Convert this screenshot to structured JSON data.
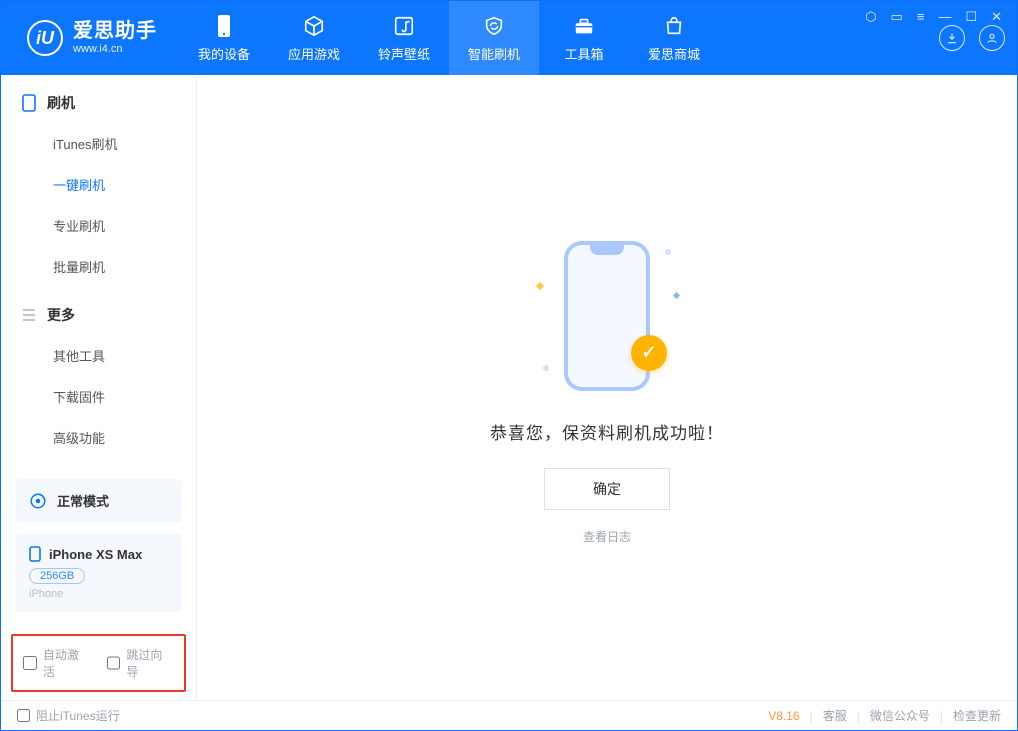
{
  "brand": {
    "name": "爱思助手",
    "url": "www.i4.cn"
  },
  "nav": {
    "tabs": [
      {
        "label": "我的设备"
      },
      {
        "label": "应用游戏"
      },
      {
        "label": "铃声壁纸"
      },
      {
        "label": "智能刷机"
      },
      {
        "label": "工具箱"
      },
      {
        "label": "爱思商城"
      }
    ],
    "active_index": 3
  },
  "sidebar": {
    "sections": [
      {
        "title": "刷机",
        "items": [
          "iTunes刷机",
          "一键刷机",
          "专业刷机",
          "批量刷机"
        ],
        "active_index": 1
      },
      {
        "title": "更多",
        "items": [
          "其他工具",
          "下载固件",
          "高级功能"
        ],
        "active_index": -1
      }
    ],
    "mode": "正常模式",
    "device": {
      "name": "iPhone XS Max",
      "capacity": "256GB",
      "type": "iPhone"
    },
    "options": {
      "auto_activate": "自动激活",
      "skip_guide": "跳过向导"
    }
  },
  "content": {
    "success_message": "恭喜您，保资料刷机成功啦！",
    "ok_button": "确定",
    "view_log": "查看日志"
  },
  "statusbar": {
    "block_itunes": "阻止iTunes运行",
    "version": "V8.16",
    "links": [
      "客服",
      "微信公众号",
      "检查更新"
    ]
  },
  "colors": {
    "primary": "#0d76ff",
    "accent": "#ffb400"
  }
}
